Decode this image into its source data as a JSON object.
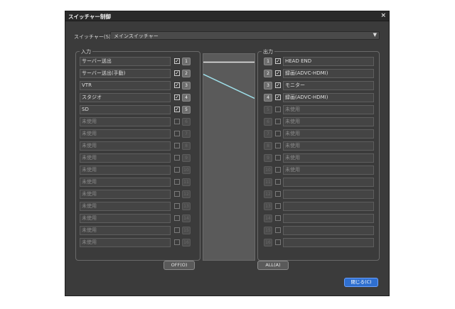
{
  "window": {
    "title": "スイッチャー制御",
    "close_glyph": "×"
  },
  "switcher": {
    "label": "スイッチャー(S):",
    "value": "メインスイッチャー"
  },
  "inputs": {
    "label": "入力",
    "rows": [
      {
        "name": "サーバー送出",
        "checked": true,
        "num": "1",
        "dim": false
      },
      {
        "name": "サーバー送出(手動)",
        "checked": true,
        "num": "2",
        "dim": false
      },
      {
        "name": "VTR",
        "checked": true,
        "num": "3",
        "dim": false
      },
      {
        "name": "スタジオ",
        "checked": true,
        "num": "4",
        "dim": false
      },
      {
        "name": "SD",
        "checked": true,
        "num": "5",
        "dim": false
      },
      {
        "name": "未使用",
        "checked": false,
        "num": "6",
        "dim": true
      },
      {
        "name": "未使用",
        "checked": false,
        "num": "7",
        "dim": true
      },
      {
        "name": "未使用",
        "checked": false,
        "num": "8",
        "dim": true
      },
      {
        "name": "未使用",
        "checked": false,
        "num": "9",
        "dim": true
      },
      {
        "name": "未使用",
        "checked": false,
        "num": "10",
        "dim": true
      },
      {
        "name": "未使用",
        "checked": false,
        "num": "11",
        "dim": true
      },
      {
        "name": "未使用",
        "checked": false,
        "num": "12",
        "dim": true
      },
      {
        "name": "未使用",
        "checked": false,
        "num": "13",
        "dim": true
      },
      {
        "name": "未使用",
        "checked": false,
        "num": "14",
        "dim": true
      },
      {
        "name": "未使用",
        "checked": false,
        "num": "15",
        "dim": true
      },
      {
        "name": "未使用",
        "checked": false,
        "num": "16",
        "dim": true
      }
    ]
  },
  "outputs": {
    "label": "出力",
    "rows": [
      {
        "name": "HEAD END",
        "checked": true,
        "num": "1",
        "dim": false
      },
      {
        "name": "録画(ADVC-HDMI)",
        "checked": true,
        "num": "2",
        "dim": false
      },
      {
        "name": "モニター",
        "checked": true,
        "num": "3",
        "dim": false
      },
      {
        "name": "録画(ADVC-HDMI)",
        "checked": true,
        "num": "4",
        "dim": false
      },
      {
        "name": "未使用",
        "checked": false,
        "num": "5",
        "dim": true
      },
      {
        "name": "未使用",
        "checked": false,
        "num": "6",
        "dim": true
      },
      {
        "name": "未使用",
        "checked": false,
        "num": "7",
        "dim": true
      },
      {
        "name": "未使用",
        "checked": false,
        "num": "8",
        "dim": true
      },
      {
        "name": "未使用",
        "checked": false,
        "num": "9",
        "dim": true
      },
      {
        "name": "未使用",
        "checked": false,
        "num": "10",
        "dim": true
      },
      {
        "name": "",
        "checked": false,
        "num": "11",
        "dim": true
      },
      {
        "name": "",
        "checked": false,
        "num": "12",
        "dim": true
      },
      {
        "name": "",
        "checked": false,
        "num": "13",
        "dim": true
      },
      {
        "name": "",
        "checked": false,
        "num": "14",
        "dim": true
      },
      {
        "name": "",
        "checked": false,
        "num": "15",
        "dim": true
      },
      {
        "name": "",
        "checked": false,
        "num": "16",
        "dim": true
      }
    ]
  },
  "routes": [
    {
      "input": "1",
      "output": "1",
      "color": "#e8e8e8"
    },
    {
      "input": "2",
      "output": "4",
      "color": "#9fe0ea"
    }
  ],
  "buttons": {
    "off": "OFF(O)",
    "all": "ALL(A)",
    "close": "閉じる(C)"
  },
  "colors": {
    "accent": "#2f6fcf",
    "route_selected": "#9fe0ea"
  }
}
